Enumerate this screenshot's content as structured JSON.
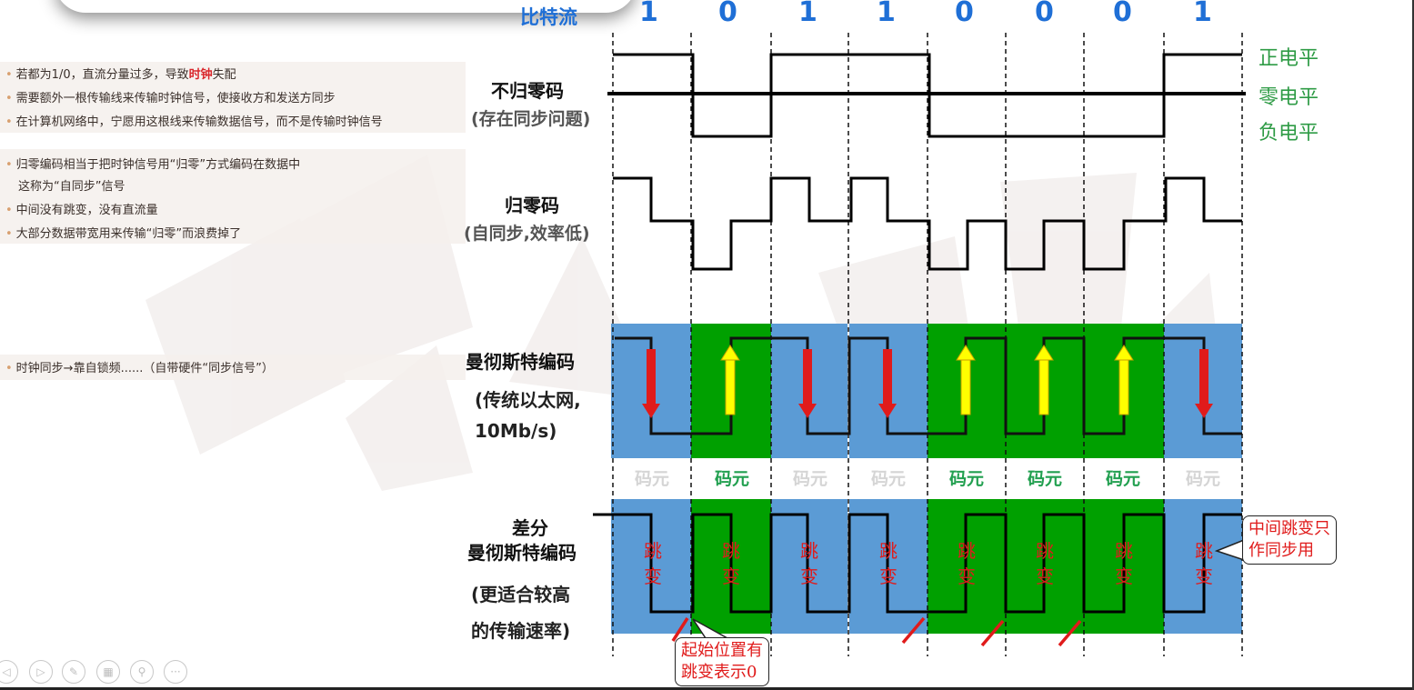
{
  "bitstream": {
    "title": "比特流",
    "bits": [
      "1",
      "0",
      "1",
      "1",
      "0",
      "0",
      "0",
      "1"
    ]
  },
  "notes": {
    "group1": [
      {
        "pre": "若都为1/0，直流分量过多，导致",
        "highlight": "时钟",
        "post": "失配"
      },
      {
        "pre": "需要额外一根传输线来传输时钟信号，使接收方和发送方同步",
        "highlight": "",
        "post": ""
      },
      {
        "pre": "在计算机网络中，宁愿用这根线来传输数据信号，而不是传输时钟信号",
        "highlight": "",
        "post": ""
      }
    ],
    "group2": [
      {
        "text": "归零编码相当于把时钟信号用“归零”方式编码在数据中"
      },
      {
        "text": "这称为“自同步”信号"
      },
      {
        "text": "中间没有跳变，没有直流量"
      },
      {
        "text": "大部分数据带宽用来传输“归零”而浪费掉了"
      }
    ],
    "group3": [
      {
        "text": "时钟同步→靠自锁频......（自带硬件“同步信号”）"
      }
    ]
  },
  "labels": {
    "nrz": "不归零码",
    "nrz_sub": "(存在同步问题)",
    "rz": "归零码",
    "rz_sub": "(自同步,效率低)",
    "manchester": "曼彻斯特编码",
    "manchester_sub1": "(传统以太网,",
    "manchester_sub2": "10Mb/s)",
    "diff1": "差分",
    "diff2": "曼彻斯特编码",
    "diff_sub1": "(更适合较高",
    "diff_sub2": "的传输速率)"
  },
  "levels": {
    "positive": "正电平",
    "zero": "零电平",
    "negative": "负电平"
  },
  "code_unit_label": "码元",
  "jump": {
    "char1": "跳",
    "char2": "变"
  },
  "callouts": {
    "start": "起始位置有\n跳变表示0",
    "start_line1": "起始位置有",
    "start_line2": "跳变表示0",
    "middle_line1": "中间跳变只",
    "middle_line2": "作同步用"
  },
  "colors": {
    "blue_bg": "#5b9bd5",
    "green_bg": "#00a000",
    "down_arrow": "#e01b1b",
    "up_arrow": "#ffff00",
    "bit_text": "#1f6fd6",
    "level_text": "#2e9b45"
  },
  "controls": [
    "prev-icon",
    "next-icon",
    "pen-icon",
    "grid-icon",
    "zoom-icon",
    "more-icon"
  ]
}
